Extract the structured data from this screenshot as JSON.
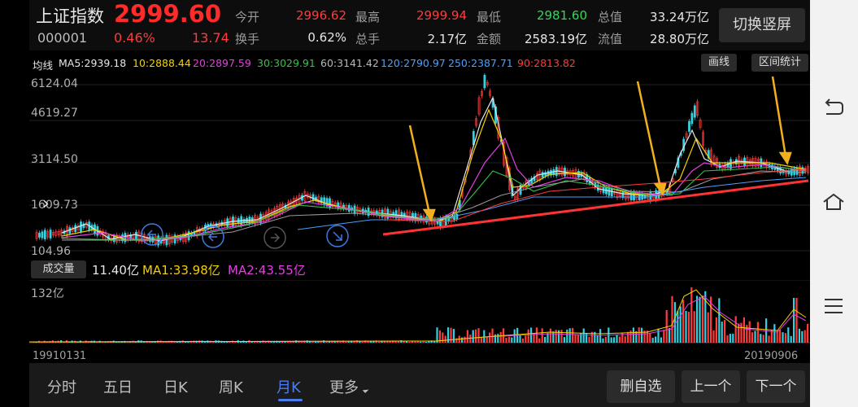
{
  "header": {
    "name": "上证指数",
    "price": "2999.60",
    "code": "000001",
    "change_pct": "0.46%",
    "change": "13.74",
    "switch_button": "切换竖屏"
  },
  "quote": [
    {
      "label": "今开",
      "value": "2996.62",
      "color": "#ff3b3b"
    },
    {
      "label": "最高",
      "value": "2999.94",
      "color": "#ff3b3b"
    },
    {
      "label": "最低",
      "value": "2981.60",
      "color": "#33d65b"
    },
    {
      "label": "总值",
      "value": "33.24万亿",
      "color": "#e6e6e6"
    },
    {
      "label": "换手",
      "value": "0.62%",
      "color": "#e6e6e6"
    },
    {
      "label": "总手",
      "value": "2.17亿",
      "color": "#e6e6e6"
    },
    {
      "label": "金额",
      "value": "2583.19亿",
      "color": "#e6e6e6"
    },
    {
      "label": "流值",
      "value": "28.80万亿",
      "color": "#e6e6e6"
    }
  ],
  "ma_line": [
    {
      "text": "均线",
      "color": "#e6e6e6"
    },
    {
      "text": "MA5:2939.18",
      "color": "#e6e6e6"
    },
    {
      "text": "10:2888.44",
      "color": "#f5d000"
    },
    {
      "text": "20:2897.59",
      "color": "#e040e0"
    },
    {
      "text": "30:3029.91",
      "color": "#33c24a"
    },
    {
      "text": "60:3141.42",
      "color": "#b8b8b8"
    },
    {
      "text": "120:2790.97",
      "color": "#4aa0ff"
    },
    {
      "text": "250:2387.71",
      "color": "#4aa0ff"
    },
    {
      "text": "90:2813.82",
      "color": "#ff3b3b"
    }
  ],
  "chart_buttons": {
    "draw": "画线",
    "range": "区间统计"
  },
  "y_labels": [
    "6124.04",
    "4619.27",
    "3114.50",
    "1609.73",
    "104.96"
  ],
  "volume": {
    "tag": "成交量",
    "value": "11.40亿",
    "ma1": "MA1:33.98亿",
    "ma2": "MA2:43.55亿",
    "axis_max": "132亿"
  },
  "dates": {
    "start": "19910131",
    "end": "20190906"
  },
  "tabs": [
    {
      "label": "分时"
    },
    {
      "label": "五日"
    },
    {
      "label": "日K"
    },
    {
      "label": "周K"
    },
    {
      "label": "月K"
    },
    {
      "label": "更多"
    }
  ],
  "bottom_buttons": {
    "delete": "删自选",
    "prev": "上一个",
    "next": "下一个"
  },
  "nav_icons": [
    "back-icon",
    "home-icon",
    "menu-icon"
  ]
}
